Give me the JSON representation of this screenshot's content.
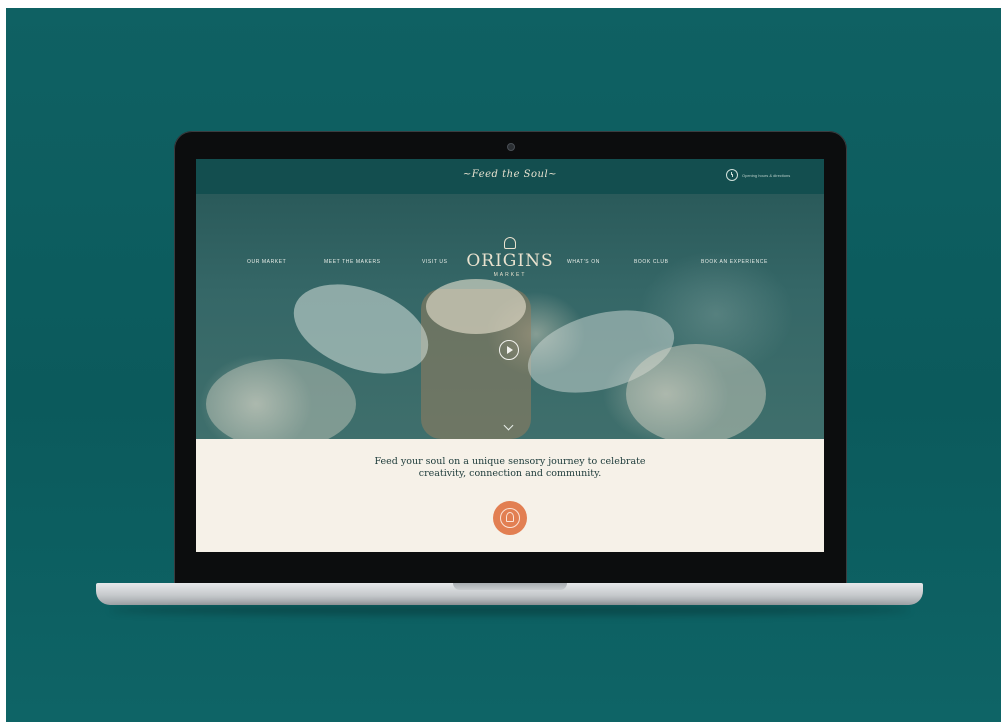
{
  "header": {
    "tagline": "~Feed the Soul~",
    "note": "Opening hours & directions"
  },
  "nav": {
    "items": [
      {
        "label": "OUR MARKET"
      },
      {
        "label": "MEET THE MAKERS"
      },
      {
        "label": "VISIT US"
      },
      {
        "label": "WHAT'S ON"
      },
      {
        "label": "BOOK CLUB"
      },
      {
        "label": "BOOK AN EXPERIENCE"
      }
    ]
  },
  "logo": {
    "name": "ORIGINS",
    "sub": "MARKET"
  },
  "intro": {
    "text": "Feed your soul on a unique sensory journey to celebrate creativity, connection and community."
  },
  "colors": {
    "background": "#0f6163",
    "topbar": "#134e4f",
    "cream": "#f6f1e8",
    "accent": "#e27f52"
  },
  "icons": {
    "play": "play-icon",
    "scroll": "chevron-down-icon",
    "badge": "origins-badge-icon",
    "clock": "clock-icon"
  }
}
